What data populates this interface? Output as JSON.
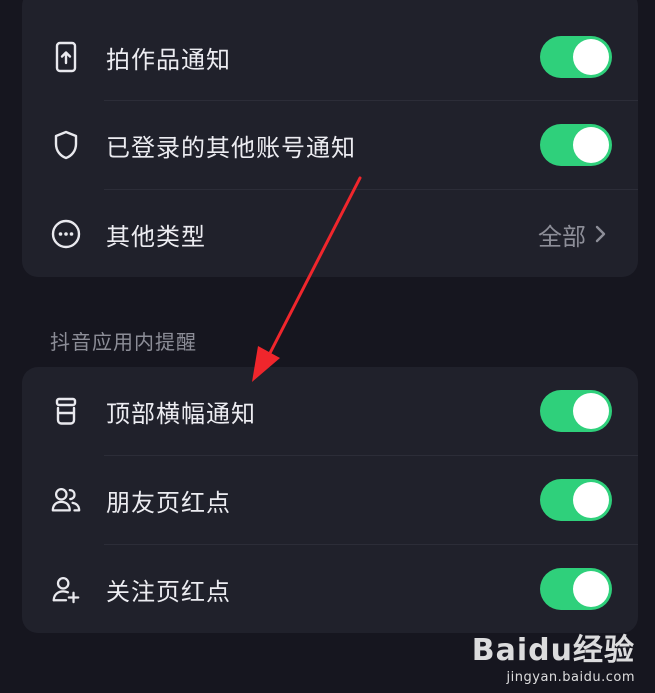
{
  "colors": {
    "background": "#16161f",
    "card": "#20212b",
    "toggle_on": "#2fd07b",
    "annotation_arrow": "#f0262c"
  },
  "card_top": {
    "rows": [
      {
        "icon": "phone-upload-icon",
        "label": "拍作品通知",
        "toggle": "on"
      },
      {
        "icon": "shield-icon",
        "label": "已登录的其他账号通知",
        "toggle": "on"
      },
      {
        "icon": "more-circle-icon",
        "label": "其他类型",
        "value": "全部",
        "trailing_icon": "chevron-right-icon"
      }
    ]
  },
  "section": {
    "title": "抖音应用内提醒"
  },
  "card_bottom": {
    "rows": [
      {
        "icon": "banner-icon",
        "label": "顶部横幅通知",
        "toggle": "on"
      },
      {
        "icon": "friends-icon",
        "label": "朋友页红点",
        "toggle": "on"
      },
      {
        "icon": "follow-user-icon",
        "label": "关注页红点",
        "toggle": "on"
      }
    ]
  },
  "watermark": {
    "brand": "Baidu经验",
    "url": "jingyan.baidu.com"
  }
}
